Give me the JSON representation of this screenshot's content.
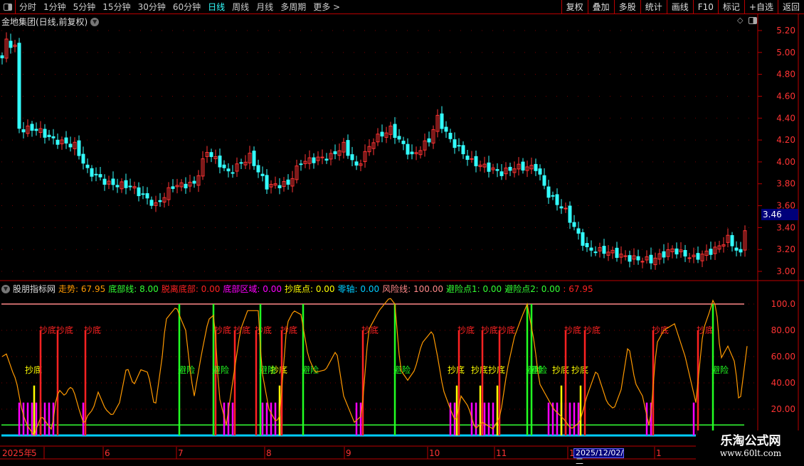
{
  "toolbar": {
    "periods": [
      "分时",
      "1分钟",
      "5分钟",
      "15分钟",
      "30分钟",
      "60分钟",
      "日线",
      "周线",
      "月线",
      "多周期",
      "更多 >"
    ],
    "active_period": "日线",
    "buttons": [
      "复权",
      "叠加",
      "多股",
      "统计",
      "画线",
      "F10",
      "标记",
      "+自选",
      "返回"
    ]
  },
  "stock": {
    "title": "金地集团(日线,前复权)",
    "current_price": "3.46"
  },
  "price_axis": {
    "ticks": [
      "5.20",
      "5.00",
      "4.80",
      "4.60",
      "4.40",
      "4.20",
      "4.00",
      "3.80",
      "3.60",
      "3.40",
      "3.20",
      "3.00"
    ]
  },
  "indicator": {
    "name": "股朋指标网",
    "legend": [
      {
        "text": "走势: 67.95",
        "color": "#ff9900"
      },
      {
        "text": "底部线: 8.00",
        "color": "#33ff33"
      },
      {
        "text": "脱离底部: 0.00",
        "color": "#ff2222"
      },
      {
        "text": "底部区域: 0.00",
        "color": "#ff00ff"
      },
      {
        "text": "抄底点: 0.00",
        "color": "#ffff00"
      },
      {
        "text": "零轴: 0.00",
        "color": "#00ccff"
      },
      {
        "text": "风险线: 100.00",
        "color": "#ff8888"
      },
      {
        "text": "避险点1: 0.00",
        "color": "#33ff33"
      },
      {
        "text": "避险点2: 0.00",
        "color": "#33ff33"
      },
      {
        "text": ": 67.95",
        "color": "#ff2222"
      }
    ],
    "ticks": [
      "100.0",
      "80.00",
      "60.00",
      "40.00",
      "20.00"
    ],
    "label_buy": "抄底",
    "label_avoid": "避险"
  },
  "date_axis": {
    "labels": [
      "2025年",
      "5",
      "6",
      "7",
      "8",
      "9",
      "10",
      "11",
      "12",
      "1"
    ],
    "cursor_date": "2025/12/02/二"
  },
  "watermark": {
    "name": "乐淘公式网",
    "url": "www.60lt.com"
  },
  "colors": {
    "up": "#ff3333",
    "down": "#33ffff",
    "trend": "#ff9900",
    "risk": "#ff8888",
    "bottom": "#33ff33",
    "zero": "#00ccff"
  },
  "chart_data": {
    "type": "candlestick+indicator",
    "price_close_approx": [
      [
        0,
        4.95
      ],
      [
        1,
        5.1
      ],
      [
        3,
        5.05
      ],
      [
        4,
        4.3
      ],
      [
        8,
        4.3
      ],
      [
        12,
        4.2
      ],
      [
        17,
        4.15
      ],
      [
        20,
        3.92
      ],
      [
        25,
        3.8
      ],
      [
        30,
        3.78
      ],
      [
        36,
        3.6
      ],
      [
        40,
        3.78
      ],
      [
        45,
        3.8
      ],
      [
        48,
        4.1
      ],
      [
        53,
        3.9
      ],
      [
        58,
        4.05
      ],
      [
        62,
        3.78
      ],
      [
        67,
        3.8
      ],
      [
        70,
        4.0
      ],
      [
        77,
        4.05
      ],
      [
        80,
        4.15
      ],
      [
        83,
        3.95
      ],
      [
        87,
        4.2
      ],
      [
        91,
        4.3
      ],
      [
        96,
        4.05
      ],
      [
        100,
        4.2
      ],
      [
        102,
        4.4
      ],
      [
        105,
        4.2
      ],
      [
        110,
        4.0
      ],
      [
        117,
        3.9
      ],
      [
        120,
        3.95
      ],
      [
        125,
        3.95
      ],
      [
        128,
        3.7
      ],
      [
        132,
        3.55
      ],
      [
        134,
        3.4
      ],
      [
        137,
        3.2
      ],
      [
        142,
        3.18
      ],
      [
        147,
        3.12
      ],
      [
        152,
        3.1
      ],
      [
        157,
        3.2
      ],
      [
        162,
        3.12
      ],
      [
        167,
        3.2
      ],
      [
        170,
        3.3
      ],
      [
        173,
        3.15
      ],
      [
        174,
        3.4
      ]
    ],
    "trend_approx": [
      [
        0,
        60
      ],
      [
        1,
        62
      ],
      [
        2.5,
        48
      ],
      [
        3.3,
        42
      ],
      [
        4.7,
        18
      ],
      [
        5.8,
        8
      ],
      [
        7.5,
        0
      ],
      [
        8,
        5
      ],
      [
        9.2,
        15
      ],
      [
        10.3,
        10
      ],
      [
        11.7,
        4
      ],
      [
        12.5,
        25
      ],
      [
        13.3,
        35
      ],
      [
        14.7,
        30
      ],
      [
        15.8,
        37
      ],
      [
        16.7,
        35
      ],
      [
        18,
        20
      ],
      [
        19.2,
        8
      ],
      [
        20,
        15
      ],
      [
        21.3,
        20
      ],
      [
        22.5,
        33
      ],
      [
        24.2,
        20
      ],
      [
        25.8,
        15
      ],
      [
        27.5,
        25
      ],
      [
        29.2,
        53
      ],
      [
        30.8,
        38
      ],
      [
        32.5,
        50
      ],
      [
        34.2,
        48
      ],
      [
        35.8,
        20
      ],
      [
        37.5,
        60
      ],
      [
        38.3,
        88
      ],
      [
        40.8,
        98
      ],
      [
        41.7,
        90
      ],
      [
        43,
        80
      ],
      [
        44.2,
        45
      ],
      [
        45,
        30
      ],
      [
        46.7,
        62
      ],
      [
        48.3,
        88
      ],
      [
        49.7,
        92
      ],
      [
        50.8,
        30
      ],
      [
        52.5,
        8
      ],
      [
        54.2,
        45
      ],
      [
        55.8,
        80
      ],
      [
        57.5,
        95
      ],
      [
        60,
        95
      ],
      [
        60.8,
        50
      ],
      [
        62.5,
        20
      ],
      [
        64.2,
        10
      ],
      [
        65,
        15
      ],
      [
        66.7,
        85
      ],
      [
        68.3,
        95
      ],
      [
        70,
        92
      ],
      [
        71.7,
        60
      ],
      [
        73.3,
        48
      ],
      [
        75.8,
        50
      ],
      [
        78.3,
        65
      ],
      [
        80,
        30
      ],
      [
        82.5,
        10
      ],
      [
        84.2,
        15
      ],
      [
        85.8,
        80
      ],
      [
        88.3,
        95
      ],
      [
        90.8,
        105
      ],
      [
        92,
        100
      ],
      [
        93.3,
        50
      ],
      [
        95,
        42
      ],
      [
        96.7,
        50
      ],
      [
        98.3,
        70
      ],
      [
        100.8,
        80
      ],
      [
        102,
        60
      ],
      [
        103.3,
        35
      ],
      [
        105,
        20
      ],
      [
        106.3,
        10
      ],
      [
        107.5,
        30
      ],
      [
        109.2,
        22
      ],
      [
        110.8,
        5
      ],
      [
        112.5,
        10
      ],
      [
        115,
        5
      ],
      [
        116.7,
        15
      ],
      [
        118.3,
        50
      ],
      [
        120,
        75
      ],
      [
        121.7,
        90
      ],
      [
        123,
        100
      ],
      [
        124.7,
        70
      ],
      [
        125.8,
        40
      ],
      [
        127.5,
        30
      ],
      [
        129.2,
        20
      ],
      [
        131.7,
        12
      ],
      [
        133.3,
        5
      ],
      [
        135.3,
        10
      ],
      [
        137,
        30
      ],
      [
        139.2,
        50
      ],
      [
        141.7,
        25
      ],
      [
        143.3,
        20
      ],
      [
        145,
        35
      ],
      [
        146.7,
        70
      ],
      [
        148.3,
        40
      ],
      [
        150,
        30
      ],
      [
        151.7,
        5
      ],
      [
        153.3,
        70
      ],
      [
        155,
        80
      ],
      [
        157.5,
        85
      ],
      [
        160,
        60
      ],
      [
        162.5,
        25
      ],
      [
        164.2,
        80
      ],
      [
        165.8,
        95
      ],
      [
        166.7,
        105
      ],
      [
        167.5,
        90
      ],
      [
        168.3,
        58
      ],
      [
        170,
        68
      ],
      [
        171.7,
        55
      ],
      [
        172.7,
        22
      ],
      [
        174.5,
        68
      ]
    ],
    "buy_signals_bar": [
      9,
      13,
      19.5,
      50,
      54.5,
      59.5,
      65.5,
      84.5,
      107,
      112.5,
      116.5,
      132,
      136.5,
      152.5,
      163
    ],
    "buy_points_bar": [
      8,
      65.5,
      107,
      112.5,
      116.5,
      131.5,
      136
    ],
    "avoid_signals_bar": [
      41.5,
      49.5,
      60.5,
      70.5,
      92,
      123,
      124,
      166.5
    ],
    "bottom_zone_bar": [
      [
        4,
        9
      ],
      [
        10,
        12
      ],
      [
        19,
        19
      ],
      [
        52,
        54
      ],
      [
        61,
        65
      ],
      [
        83,
        84
      ],
      [
        105,
        106
      ],
      [
        110,
        115
      ],
      [
        128,
        135
      ],
      [
        151,
        152
      ],
      [
        162,
        162
      ]
    ],
    "risk_line": 100,
    "bottom_line": 8,
    "zero_line": 0,
    "indicator_range": [
      0,
      110
    ],
    "price_range": [
      3.0,
      5.2
    ]
  }
}
